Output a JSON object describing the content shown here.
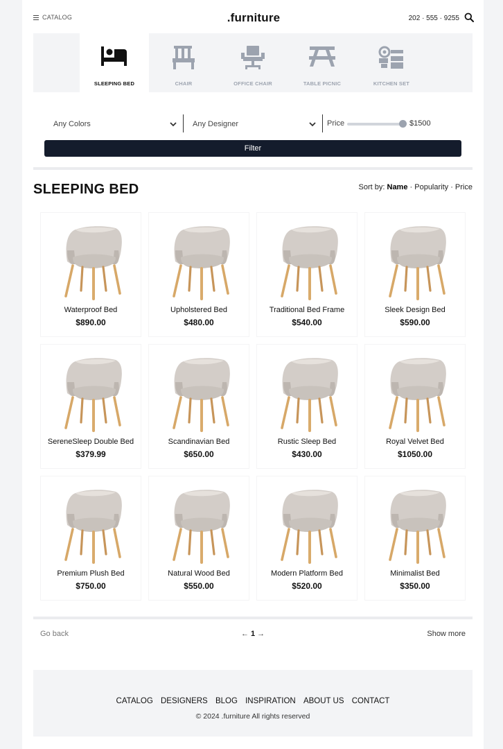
{
  "header": {
    "catalog_label": "CATALOG",
    "logo": ".furniture",
    "phone": "202 · 555 · 9255"
  },
  "categories": [
    {
      "label": "SLEEPING BED",
      "icon": "bed-icon",
      "active": true
    },
    {
      "label": "CHAIR",
      "icon": "chair-icon",
      "active": false
    },
    {
      "label": "OFFICE CHAIR",
      "icon": "office-chair-icon",
      "active": false
    },
    {
      "label": "TABLE PICNIC",
      "icon": "picnic-table-icon",
      "active": false
    },
    {
      "label": "KITCHEN SET",
      "icon": "kitchen-set-icon",
      "active": false
    }
  ],
  "filters": {
    "color_value": "Any Colors",
    "designer_value": "Any Designer",
    "price_label": "Price",
    "price_max": "$1500",
    "button_label": "Filter"
  },
  "section": {
    "title": "SLEEPING BED",
    "sort_prefix": "Sort by:",
    "sort_name": "Name",
    "sort_rest": " · Popularity · Price"
  },
  "products": [
    {
      "name": "Waterproof Bed",
      "price": "$890.00"
    },
    {
      "name": "Upholstered Bed",
      "price": "$480.00"
    },
    {
      "name": "Traditional Bed Frame",
      "price": "$540.00"
    },
    {
      "name": "Sleek Design Bed",
      "price": "$590.00"
    },
    {
      "name": "SereneSleep Double Bed",
      "price": "$379.99"
    },
    {
      "name": "Scandinavian Bed",
      "price": "$650.00"
    },
    {
      "name": "Rustic Sleep Bed",
      "price": "$430.00"
    },
    {
      "name": "Royal Velvet Bed",
      "price": "$1050.00"
    },
    {
      "name": "Premium Plush Bed",
      "price": "$750.00"
    },
    {
      "name": "Natural Wood Bed",
      "price": "$550.00"
    },
    {
      "name": "Modern Platform Bed",
      "price": "$520.00"
    },
    {
      "name": "Minimalist Bed",
      "price": "$350.00"
    }
  ],
  "pagination": {
    "back_label": "Go back",
    "prev_arrow": "←",
    "current_page": "1",
    "next_arrow": "→",
    "more_label": "Show more"
  },
  "footer": {
    "links": [
      "CATALOG",
      "DESIGNERS",
      "BLOG",
      "INSPIRATION",
      "ABOUT US",
      "CONTACT"
    ],
    "copyright": "© 2024 .furniture All rights reserved"
  }
}
